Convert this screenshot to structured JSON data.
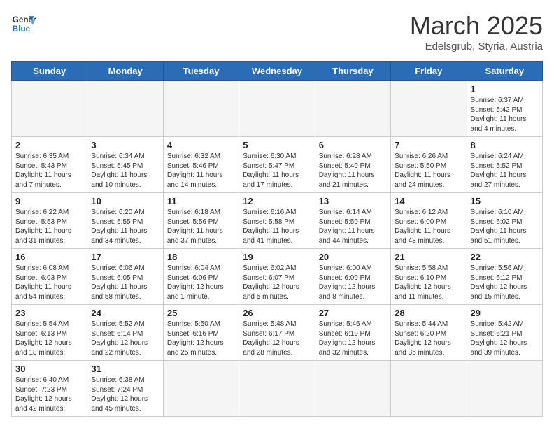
{
  "logo": {
    "line1": "General",
    "line2": "Blue"
  },
  "title": "March 2025",
  "subtitle": "Edelsgrub, Styria, Austria",
  "days_of_week": [
    "Sunday",
    "Monday",
    "Tuesday",
    "Wednesday",
    "Thursday",
    "Friday",
    "Saturday"
  ],
  "weeks": [
    [
      {
        "day": "",
        "info": ""
      },
      {
        "day": "",
        "info": ""
      },
      {
        "day": "",
        "info": ""
      },
      {
        "day": "",
        "info": ""
      },
      {
        "day": "",
        "info": ""
      },
      {
        "day": "",
        "info": ""
      },
      {
        "day": "1",
        "info": "Sunrise: 6:37 AM\nSunset: 5:42 PM\nDaylight: 11 hours and 4 minutes."
      }
    ],
    [
      {
        "day": "2",
        "info": "Sunrise: 6:35 AM\nSunset: 5:43 PM\nDaylight: 11 hours and 7 minutes."
      },
      {
        "day": "3",
        "info": "Sunrise: 6:34 AM\nSunset: 5:45 PM\nDaylight: 11 hours and 10 minutes."
      },
      {
        "day": "4",
        "info": "Sunrise: 6:32 AM\nSunset: 5:46 PM\nDaylight: 11 hours and 14 minutes."
      },
      {
        "day": "5",
        "info": "Sunrise: 6:30 AM\nSunset: 5:47 PM\nDaylight: 11 hours and 17 minutes."
      },
      {
        "day": "6",
        "info": "Sunrise: 6:28 AM\nSunset: 5:49 PM\nDaylight: 11 hours and 21 minutes."
      },
      {
        "day": "7",
        "info": "Sunrise: 6:26 AM\nSunset: 5:50 PM\nDaylight: 11 hours and 24 minutes."
      },
      {
        "day": "8",
        "info": "Sunrise: 6:24 AM\nSunset: 5:52 PM\nDaylight: 11 hours and 27 minutes."
      }
    ],
    [
      {
        "day": "9",
        "info": "Sunrise: 6:22 AM\nSunset: 5:53 PM\nDaylight: 11 hours and 31 minutes."
      },
      {
        "day": "10",
        "info": "Sunrise: 6:20 AM\nSunset: 5:55 PM\nDaylight: 11 hours and 34 minutes."
      },
      {
        "day": "11",
        "info": "Sunrise: 6:18 AM\nSunset: 5:56 PM\nDaylight: 11 hours and 37 minutes."
      },
      {
        "day": "12",
        "info": "Sunrise: 6:16 AM\nSunset: 5:58 PM\nDaylight: 11 hours and 41 minutes."
      },
      {
        "day": "13",
        "info": "Sunrise: 6:14 AM\nSunset: 5:59 PM\nDaylight: 11 hours and 44 minutes."
      },
      {
        "day": "14",
        "info": "Sunrise: 6:12 AM\nSunset: 6:00 PM\nDaylight: 11 hours and 48 minutes."
      },
      {
        "day": "15",
        "info": "Sunrise: 6:10 AM\nSunset: 6:02 PM\nDaylight: 11 hours and 51 minutes."
      }
    ],
    [
      {
        "day": "16",
        "info": "Sunrise: 6:08 AM\nSunset: 6:03 PM\nDaylight: 11 hours and 54 minutes."
      },
      {
        "day": "17",
        "info": "Sunrise: 6:06 AM\nSunset: 6:05 PM\nDaylight: 11 hours and 58 minutes."
      },
      {
        "day": "18",
        "info": "Sunrise: 6:04 AM\nSunset: 6:06 PM\nDaylight: 12 hours and 1 minute."
      },
      {
        "day": "19",
        "info": "Sunrise: 6:02 AM\nSunset: 6:07 PM\nDaylight: 12 hours and 5 minutes."
      },
      {
        "day": "20",
        "info": "Sunrise: 6:00 AM\nSunset: 6:09 PM\nDaylight: 12 hours and 8 minutes."
      },
      {
        "day": "21",
        "info": "Sunrise: 5:58 AM\nSunset: 6:10 PM\nDaylight: 12 hours and 11 minutes."
      },
      {
        "day": "22",
        "info": "Sunrise: 5:56 AM\nSunset: 6:12 PM\nDaylight: 12 hours and 15 minutes."
      }
    ],
    [
      {
        "day": "23",
        "info": "Sunrise: 5:54 AM\nSunset: 6:13 PM\nDaylight: 12 hours and 18 minutes."
      },
      {
        "day": "24",
        "info": "Sunrise: 5:52 AM\nSunset: 6:14 PM\nDaylight: 12 hours and 22 minutes."
      },
      {
        "day": "25",
        "info": "Sunrise: 5:50 AM\nSunset: 6:16 PM\nDaylight: 12 hours and 25 minutes."
      },
      {
        "day": "26",
        "info": "Sunrise: 5:48 AM\nSunset: 6:17 PM\nDaylight: 12 hours and 28 minutes."
      },
      {
        "day": "27",
        "info": "Sunrise: 5:46 AM\nSunset: 6:19 PM\nDaylight: 12 hours and 32 minutes."
      },
      {
        "day": "28",
        "info": "Sunrise: 5:44 AM\nSunset: 6:20 PM\nDaylight: 12 hours and 35 minutes."
      },
      {
        "day": "29",
        "info": "Sunrise: 5:42 AM\nSunset: 6:21 PM\nDaylight: 12 hours and 39 minutes."
      }
    ],
    [
      {
        "day": "30",
        "info": "Sunrise: 6:40 AM\nSunset: 7:23 PM\nDaylight: 12 hours and 42 minutes."
      },
      {
        "day": "31",
        "info": "Sunrise: 6:38 AM\nSunset: 7:24 PM\nDaylight: 12 hours and 45 minutes."
      },
      {
        "day": "",
        "info": ""
      },
      {
        "day": "",
        "info": ""
      },
      {
        "day": "",
        "info": ""
      },
      {
        "day": "",
        "info": ""
      },
      {
        "day": "",
        "info": ""
      }
    ]
  ]
}
